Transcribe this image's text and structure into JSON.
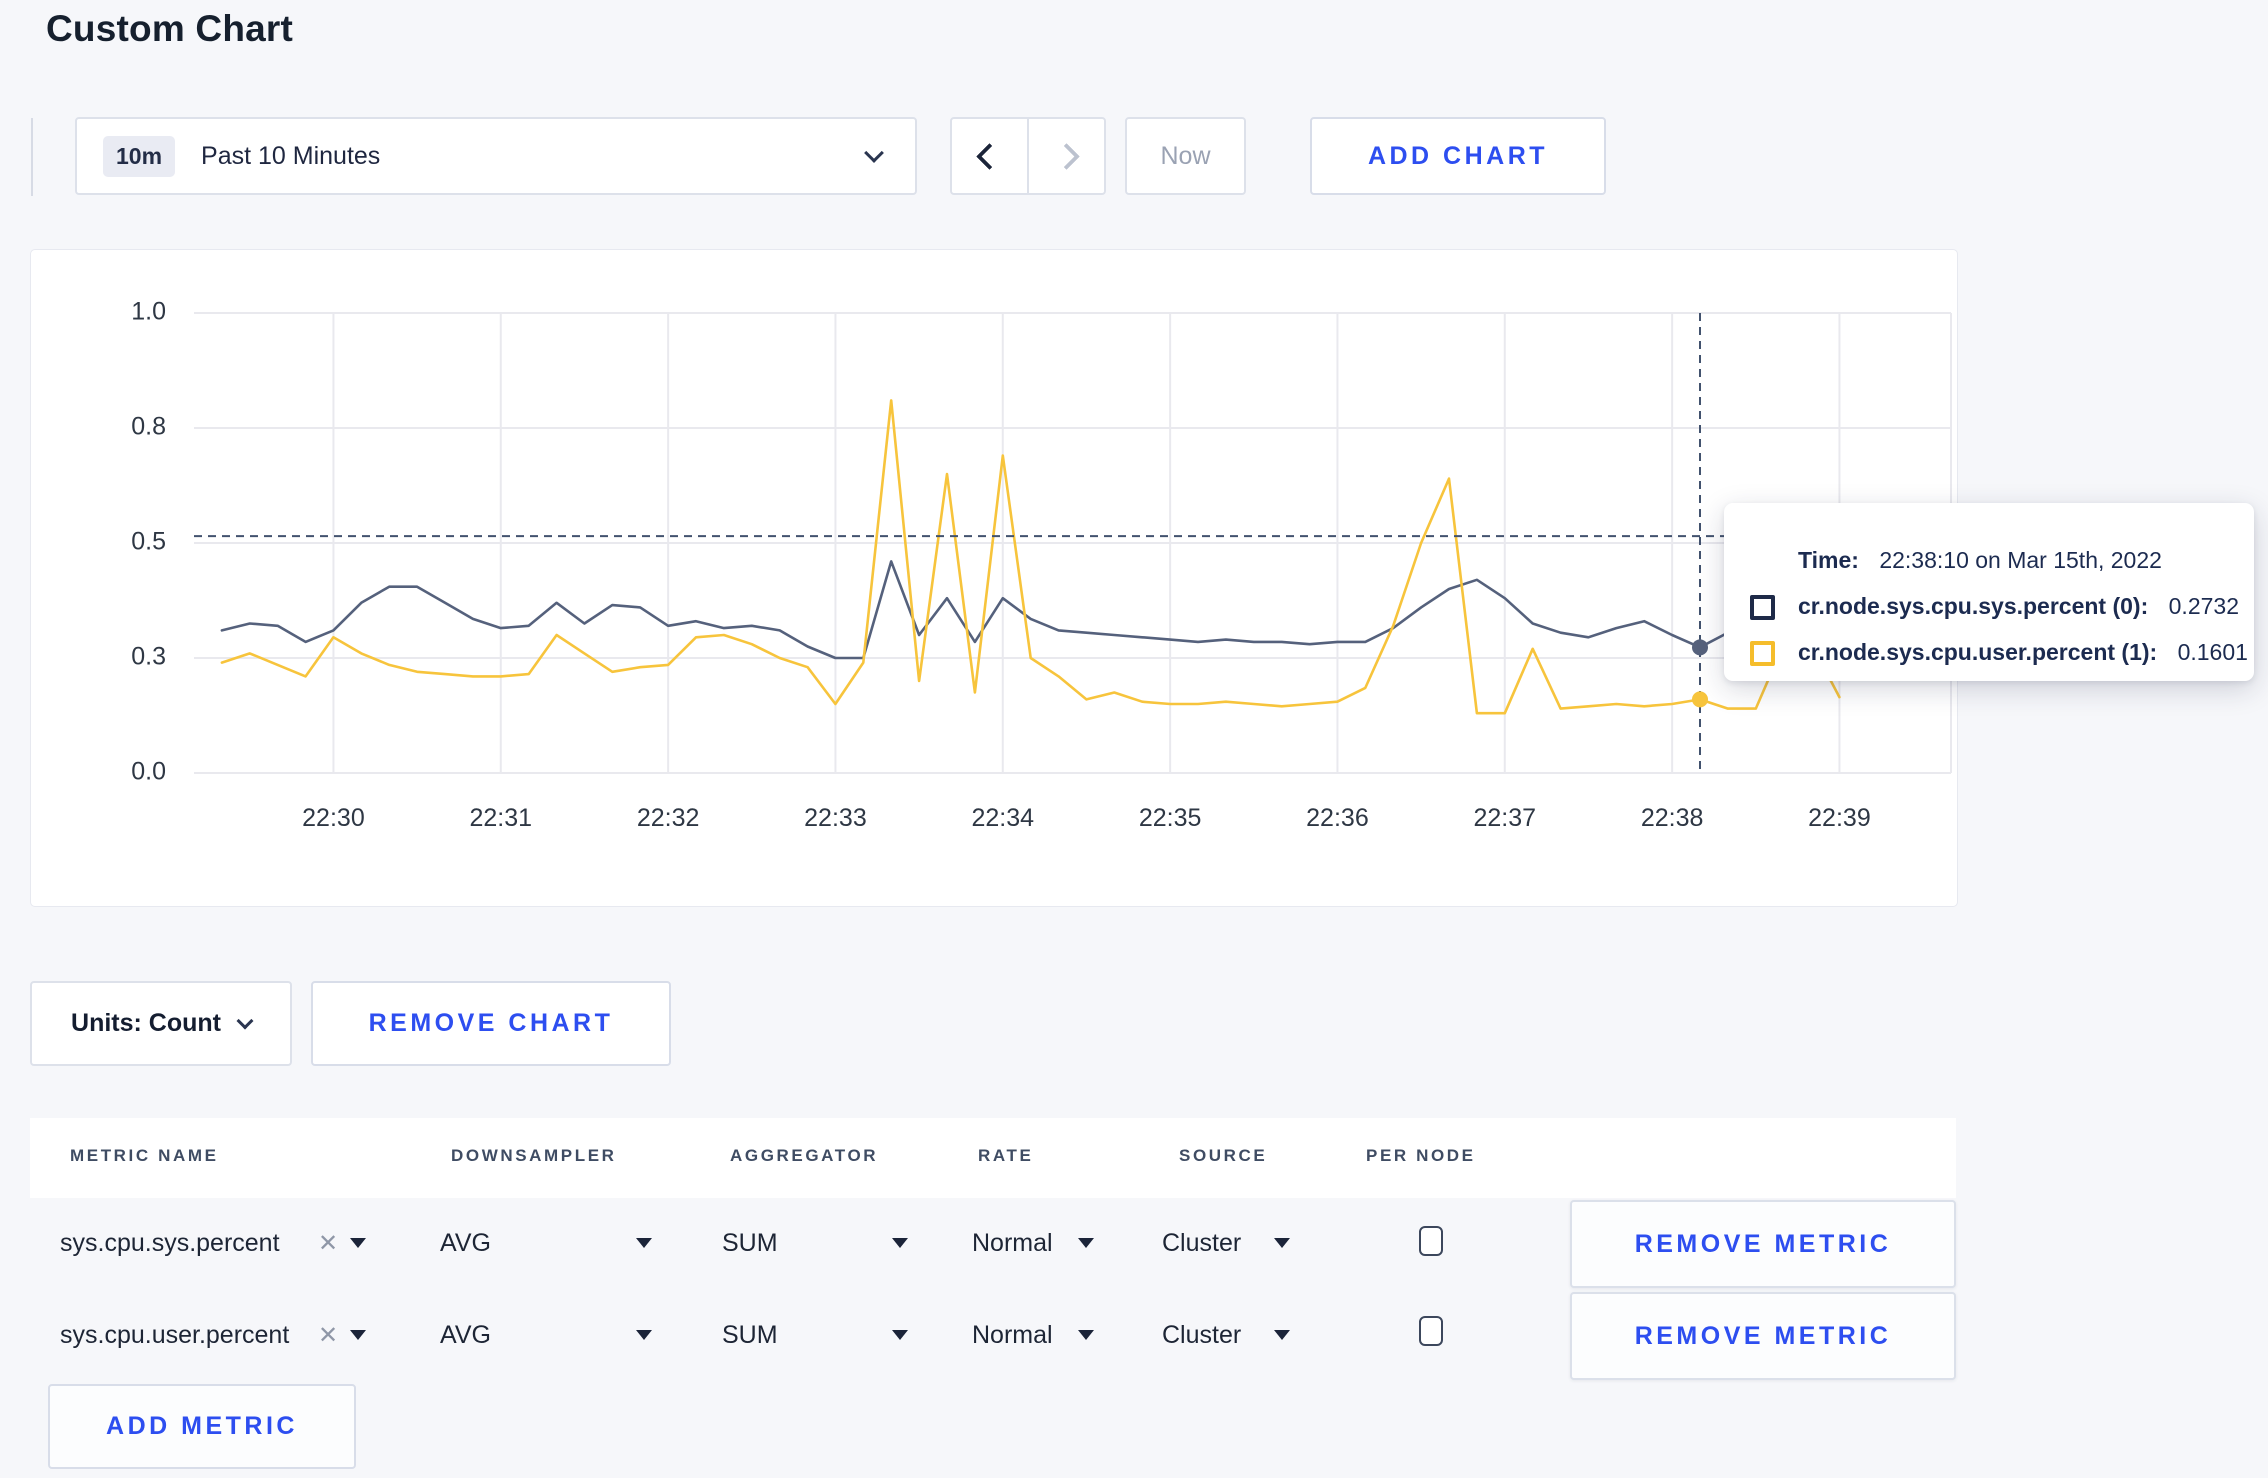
{
  "title": "Custom Chart",
  "toolbar": {
    "range_badge": "10m",
    "range_label": "Past 10 Minutes",
    "prev_icon": "chevron-left",
    "next_icon": "chevron-right",
    "now_label": "Now",
    "add_chart_label": "ADD CHART"
  },
  "chart_data": {
    "type": "line",
    "title": "",
    "xlabel": "",
    "ylabel": "",
    "ylim": [
      0,
      1.0
    ],
    "grid": true,
    "y_tick_values": [
      0,
      0.25,
      0.5,
      0.75,
      1.0
    ],
    "y_tick_labels": [
      "0.0",
      "0.3",
      "0.5",
      "0.8",
      "1.0"
    ],
    "x_tick_seconds": [
      0,
      60,
      120,
      180,
      240,
      300,
      360,
      420,
      480,
      540
    ],
    "x_tick_labels": [
      "22:30",
      "22:31",
      "22:32",
      "22:33",
      "22:34",
      "22:35",
      "22:36",
      "22:37",
      "22:38",
      "22:39"
    ],
    "x_domain_seconds": [
      -50,
      580
    ],
    "start_offset_seconds": -40,
    "sample_interval_seconds": 10,
    "series": [
      {
        "name": "cr.node.sys.cpu.sys.percent",
        "color": "#55617c",
        "values": [
          0.31,
          0.325,
          0.32,
          0.285,
          0.31,
          0.37,
          0.405,
          0.405,
          0.37,
          0.335,
          0.315,
          0.32,
          0.37,
          0.325,
          0.365,
          0.36,
          0.32,
          0.33,
          0.315,
          0.32,
          0.31,
          0.275,
          0.25,
          0.25,
          0.46,
          0.3,
          0.38,
          0.285,
          0.38,
          0.335,
          0.31,
          0.305,
          0.3,
          0.295,
          0.29,
          0.285,
          0.29,
          0.285,
          0.285,
          0.28,
          0.285,
          0.285,
          0.315,
          0.36,
          0.4,
          0.42,
          0.38,
          0.325,
          0.305,
          0.295,
          0.315,
          0.33,
          0.3,
          0.2732,
          0.305,
          0.3,
          0.295,
          0.3,
          0.29
        ]
      },
      {
        "name": "cr.node.sys.cpu.user.percent",
        "color": "#f7c43c",
        "values": [
          0.24,
          0.26,
          0.235,
          0.21,
          0.295,
          0.26,
          0.235,
          0.22,
          0.215,
          0.21,
          0.21,
          0.215,
          0.3,
          0.26,
          0.22,
          0.23,
          0.235,
          0.295,
          0.3,
          0.28,
          0.25,
          0.23,
          0.15,
          0.24,
          0.81,
          0.2,
          0.65,
          0.175,
          0.69,
          0.25,
          0.21,
          0.16,
          0.175,
          0.155,
          0.15,
          0.15,
          0.155,
          0.15,
          0.145,
          0.15,
          0.155,
          0.185,
          0.32,
          0.5,
          0.64,
          0.13,
          0.13,
          0.27,
          0.14,
          0.145,
          0.15,
          0.145,
          0.15,
          0.1601,
          0.14,
          0.14,
          0.28,
          0.28,
          0.165
        ]
      }
    ],
    "crosshair": {
      "time_offset_seconds": 490,
      "time_label": "22:38:10",
      "y_value": 0.515,
      "color": "#42526e"
    },
    "legend_position": "tooltip",
    "gridline_color": "#e9e9ee",
    "axis_text_color": "#2e3744"
  },
  "tooltip": {
    "time_label": "Time:",
    "time_value": "22:38:10 on Mar 15th, 2022",
    "series": [
      {
        "label": "cr.node.sys.cpu.sys.percent (0):",
        "value": "0.2732",
        "swatch_color": "#1e2a48"
      },
      {
        "label": "cr.node.sys.cpu.user.percent (1):",
        "value": "0.1601",
        "swatch_color": "#f5bd2b"
      }
    ]
  },
  "chart_footer": {
    "units_label": "Units: Count",
    "remove_chart_label": "REMOVE CHART"
  },
  "metrics_table": {
    "headers": [
      "METRIC NAME",
      "DOWNSAMPLER",
      "AGGREGATOR",
      "RATE",
      "SOURCE",
      "PER NODE"
    ],
    "rows": [
      {
        "name": "sys.cpu.sys.percent",
        "downsampler": "AVG",
        "aggregator": "SUM",
        "rate": "Normal",
        "source": "Cluster",
        "per_node_checked": false,
        "remove_label": "REMOVE METRIC"
      },
      {
        "name": "sys.cpu.user.percent",
        "downsampler": "AVG",
        "aggregator": "SUM",
        "rate": "Normal",
        "source": "Cluster",
        "per_node_checked": false,
        "remove_label": "REMOVE METRIC"
      }
    ],
    "add_metric_label": "ADD METRIC"
  },
  "colors": {
    "accent_blue": "#2d4ef0",
    "page_background": "#f6f7fa",
    "panel_background": "#ffffff",
    "series_sys": "#55617c",
    "series_user": "#f7c43c"
  }
}
